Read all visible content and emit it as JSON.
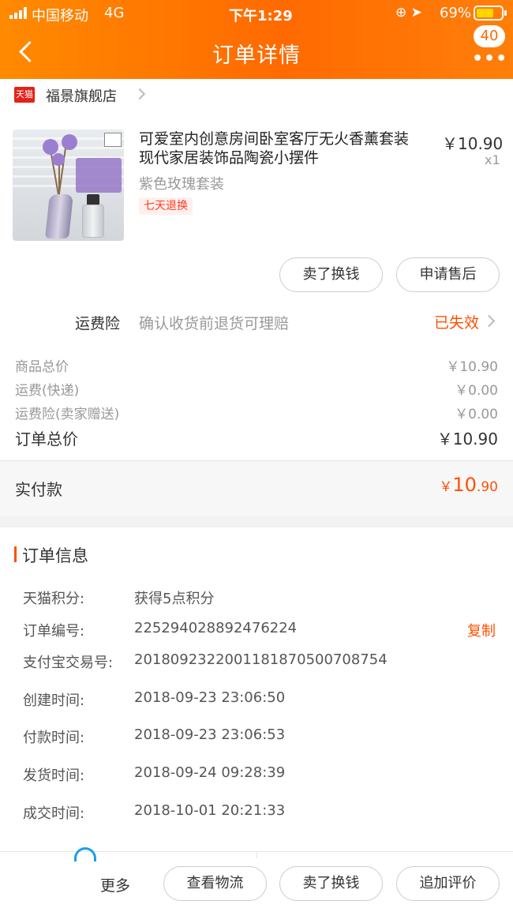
{
  "status_bar": {
    "carrier": "中国移动",
    "network": "4G",
    "time": "下午1:29",
    "battery_percent": "69%",
    "battery_level": 0.69
  },
  "nav": {
    "title": "订单详情",
    "message_count": "40"
  },
  "shop": {
    "badge": "天猫",
    "name": "福景旗舰店"
  },
  "product": {
    "title": "可爱室内创意房间卧室客厅无火香薰套装现代家居装饰品陶瓷小摆件",
    "price": "￥10.90",
    "quantity": "x1",
    "sku": "紫色玫瑰套装",
    "tag": "七天退换",
    "actions": {
      "sell": "卖了换钱",
      "after_sale": "申请售后"
    }
  },
  "insurance": {
    "label": "运费险",
    "desc": "确认收货前退货可理赔",
    "status": "已失效"
  },
  "summary": {
    "rows": [
      {
        "label": "商品总价",
        "value": "￥10.90"
      },
      {
        "label": "运费(快递)",
        "value": "￥0.00"
      },
      {
        "label": "运费险(卖家赠送)",
        "value": "￥0.00"
      }
    ],
    "total_label": "订单总价",
    "total_value": "￥10.90"
  },
  "paid": {
    "label": "实付款",
    "currency": "￥",
    "integer": "10",
    "decimal": ".90"
  },
  "order_info": {
    "heading": "订单信息",
    "rows": [
      {
        "key": "天猫积分:",
        "value": "获得5点积分"
      },
      {
        "key": "订单编号:",
        "value": "225294028892476224"
      },
      {
        "key": "支付宝交易号:",
        "value": "2018092322001181870500708754"
      },
      {
        "key": "创建时间:",
        "value": "2018-09-23 23:06:50"
      },
      {
        "key": "付款时间:",
        "value": "2018-09-23 23:06:53"
      },
      {
        "key": "发货时间:",
        "value": "2018-09-24 09:28:39"
      },
      {
        "key": "成交时间:",
        "value": "2018-10-01 20:21:33"
      }
    ],
    "copy_label": "复制"
  },
  "bottom_bar": {
    "more": "更多",
    "logistics": "查看物流",
    "sell": "卖了换钱",
    "review": "追加评价"
  },
  "colors": {
    "accent": "#ff5000",
    "nav_gradient_start": "#ff8a00",
    "nav_gradient_end": "#ff6a00"
  }
}
